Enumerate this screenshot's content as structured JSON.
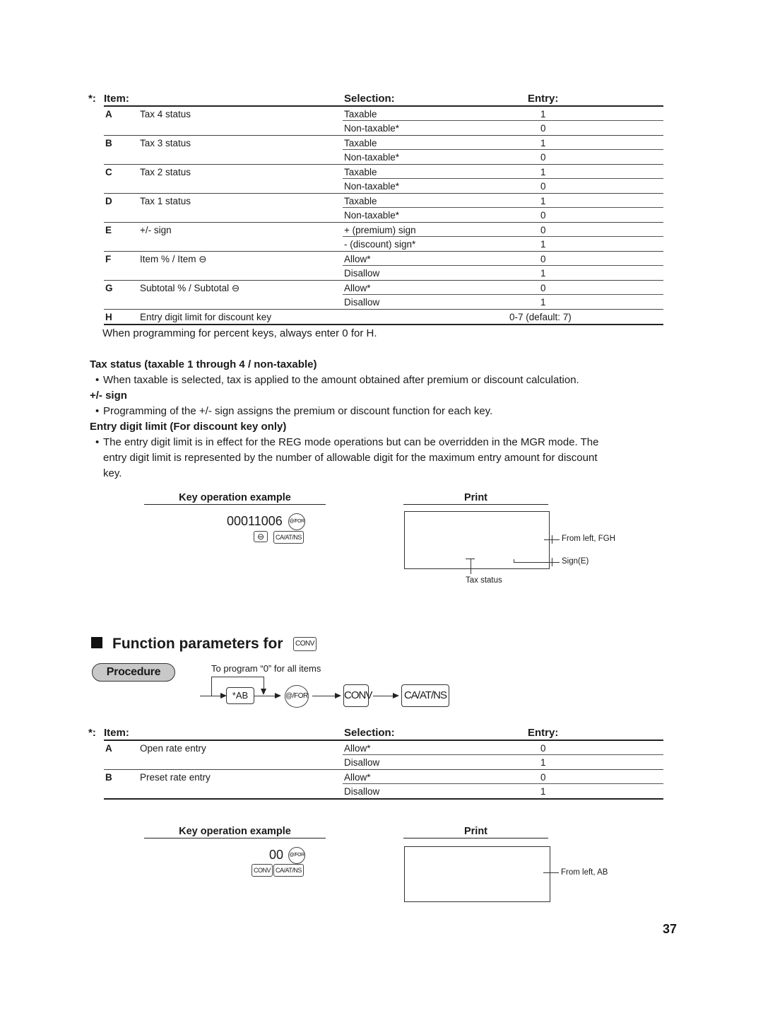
{
  "table1": {
    "headers": {
      "star": "*:",
      "item": "Item:",
      "selection": "Selection:",
      "entry": "Entry:"
    },
    "rows": [
      {
        "key": "A",
        "item": "Tax 4 status",
        "options": [
          {
            "selection": "Taxable",
            "entry": "1"
          },
          {
            "selection": "Non-taxable*",
            "entry": "0"
          }
        ]
      },
      {
        "key": "B",
        "item": "Tax 3 status",
        "options": [
          {
            "selection": "Taxable",
            "entry": "1"
          },
          {
            "selection": "Non-taxable*",
            "entry": "0"
          }
        ]
      },
      {
        "key": "C",
        "item": "Tax 2 status",
        "options": [
          {
            "selection": "Taxable",
            "entry": "1"
          },
          {
            "selection": "Non-taxable*",
            "entry": "0"
          }
        ]
      },
      {
        "key": "D",
        "item": "Tax 1 status",
        "options": [
          {
            "selection": "Taxable",
            "entry": "1"
          },
          {
            "selection": "Non-taxable*",
            "entry": "0"
          }
        ]
      },
      {
        "key": "E",
        "item": "+/- sign",
        "options": [
          {
            "selection": "+ (premium) sign",
            "entry": "0"
          },
          {
            "selection": "- (discount) sign*",
            "entry": "1"
          }
        ]
      },
      {
        "key": "F",
        "item": "Item % / Item ⊖",
        "options": [
          {
            "selection": "Allow*",
            "entry": "0"
          },
          {
            "selection": "Disallow",
            "entry": "1"
          }
        ]
      },
      {
        "key": "G",
        "item": "Subtotal % / Subtotal ⊖",
        "options": [
          {
            "selection": "Allow*",
            "entry": "0"
          },
          {
            "selection": "Disallow",
            "entry": "1"
          }
        ]
      },
      {
        "key": "H",
        "item": "Entry digit limit for discount key",
        "entry": "0-7 (default: 7)"
      }
    ],
    "note": "When programming for percent keys, always enter 0 for H."
  },
  "notes": {
    "tax_status_heading": "Tax status (taxable 1 through 4 / non-taxable)",
    "tax_status_bullet": "When taxable is selected, tax is applied to the amount obtained after premium or discount calculation.",
    "sign_heading": "+/- sign",
    "sign_bullet": "Programming of the +/- sign assigns the premium or discount function for each key.",
    "limit_heading": "Entry digit limit (For discount key only)",
    "limit_bullet_line1": "The entry digit limit is in effect for the REG mode operations but can be overridden in the MGR mode.  The",
    "limit_bullet_line2": "entry digit limit is represented by the number of allowable digit for the maximum entry amount for discount",
    "limit_bullet_line3": "key.",
    "bullet_char": "•"
  },
  "example1": {
    "key_op_heading": "Key operation example",
    "print_heading": "Print",
    "entry_digits": "00011006",
    "keys": {
      "at_for": "@/FOR",
      "minus": "⊖",
      "ca_at_ns": "CA/AT/NS"
    },
    "labels": {
      "from_left": "From left, FGH",
      "sign": "Sign(E)",
      "tax_status": "Tax status"
    }
  },
  "section2": {
    "title": "Function parameters for",
    "title_key": "CONV",
    "procedure_label": "Procedure",
    "flow_note": "To program “0” for all items",
    "flow": {
      "ab": "*AB",
      "at_for": "@/FOR",
      "conv": "CONV",
      "ca_at_ns": "CA/AT/NS"
    }
  },
  "table2": {
    "headers": {
      "star": "*:",
      "item": "Item:",
      "selection": "Selection:",
      "entry": "Entry:"
    },
    "rows": [
      {
        "key": "A",
        "item": "Open rate entry",
        "options": [
          {
            "selection": "Allow*",
            "entry": "0"
          },
          {
            "selection": "Disallow",
            "entry": "1"
          }
        ]
      },
      {
        "key": "B",
        "item": "Preset rate entry",
        "options": [
          {
            "selection": "Allow*",
            "entry": "0"
          },
          {
            "selection": "Disallow",
            "entry": "1"
          }
        ]
      }
    ]
  },
  "example2": {
    "key_op_heading": "Key operation example",
    "print_heading": "Print",
    "entry_digits": "00",
    "keys": {
      "at_for": "@/FOR",
      "conv": "CONV",
      "ca_at_ns": "CA/AT/NS"
    },
    "labels": {
      "from_left": "From left, AB"
    }
  },
  "page_number": "37"
}
